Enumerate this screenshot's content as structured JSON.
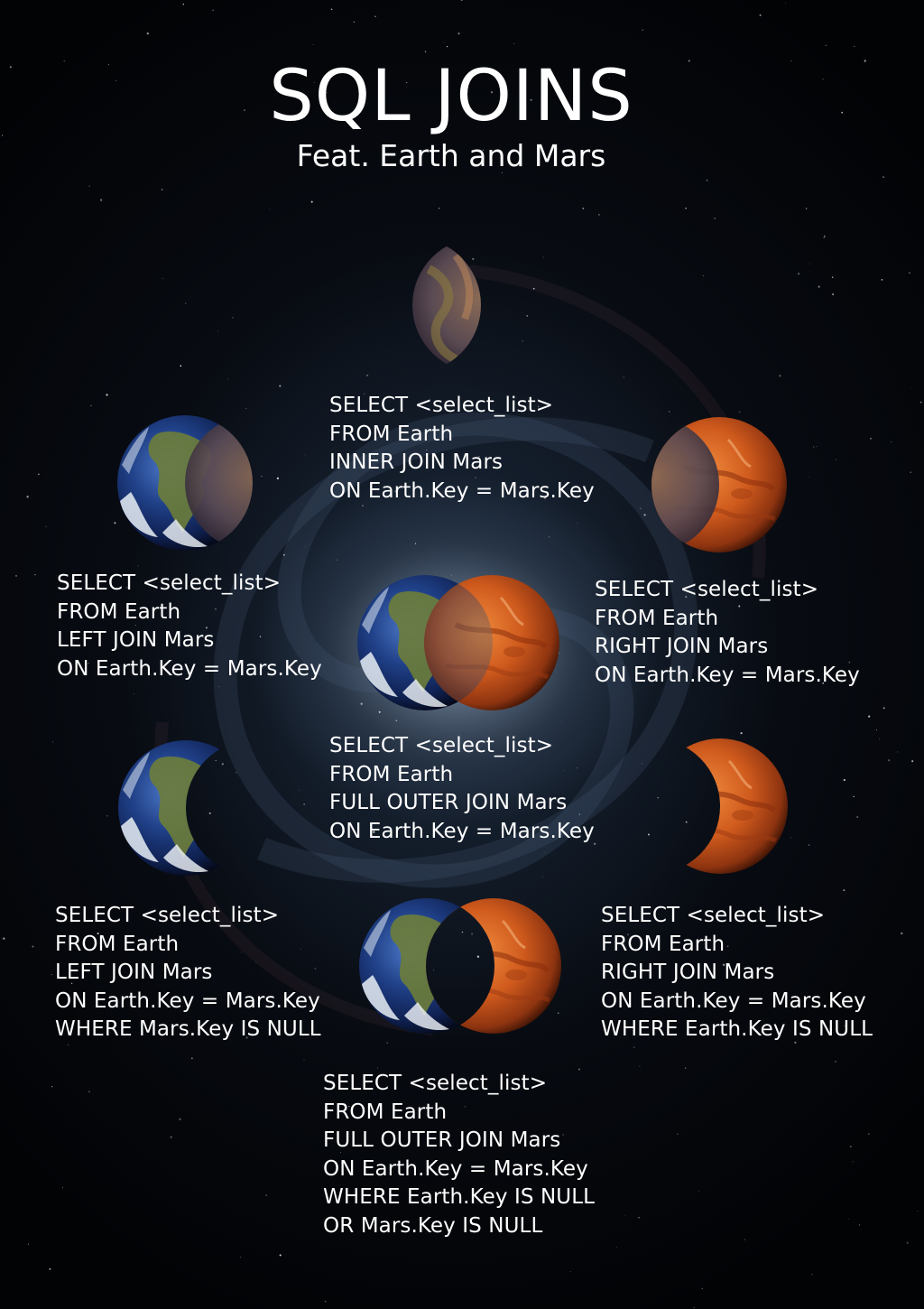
{
  "header": {
    "title": "SQL JOINS",
    "subtitle": "Feat. Earth and Mars"
  },
  "colors": {
    "earth_ocean": "#1d3b7a",
    "earth_land": "#6b7a3a",
    "mars": "#c8561e",
    "background": "#05070c",
    "text": "#ffffff"
  },
  "joins": {
    "inner": [
      "SELECT <select_list>",
      "FROM Earth",
      "INNER JOIN Mars",
      "ON Earth.Key = Mars.Key"
    ],
    "left": [
      "SELECT <select_list>",
      "FROM Earth",
      "LEFT JOIN Mars",
      "ON Earth.Key = Mars.Key"
    ],
    "right": [
      "SELECT <select_list>",
      "FROM Earth",
      "RIGHT JOIN Mars",
      "ON Earth.Key = Mars.Key"
    ],
    "full": [
      "SELECT <select_list>",
      "FROM Earth",
      "FULL OUTER JOIN Mars",
      "ON Earth.Key = Mars.Key"
    ],
    "left_excl": [
      "SELECT <select_list>",
      "FROM Earth",
      "LEFT JOIN Mars",
      "ON Earth.Key = Mars.Key",
      "WHERE Mars.Key IS NULL"
    ],
    "right_excl": [
      "SELECT <select_list>",
      "FROM Earth",
      "RIGHT JOIN Mars",
      "ON Earth.Key = Mars.Key",
      "WHERE Earth.Key IS NULL"
    ],
    "full_excl": [
      "SELECT <select_list>",
      "FROM Earth",
      "FULL OUTER JOIN Mars",
      "ON Earth.Key = Mars.Key",
      "WHERE Earth.Key IS NULL",
      "OR Mars.Key IS NULL"
    ]
  }
}
